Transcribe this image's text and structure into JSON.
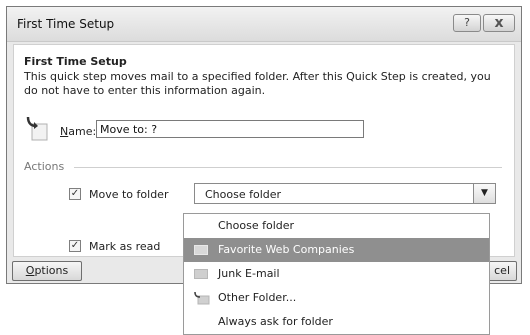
{
  "dialog": {
    "title": "First Time Setup",
    "help_glyph": "?",
    "close_glyph": "x"
  },
  "content": {
    "heading": "First Time Setup",
    "description": "This quick step moves mail to a specified folder. After this Quick Step is created, you do not have to enter this information again.",
    "name_label_mnemonic": "N",
    "name_label_rest": "ame:",
    "name_value": "Move to: ?",
    "actions_label": "Actions"
  },
  "actions": {
    "move_to_folder": {
      "label": "Move to folder",
      "checked": true
    },
    "mark_as_read": {
      "label": "Mark as read",
      "checked": true
    },
    "folder_combo_value": "Choose folder"
  },
  "footer": {
    "options_mnemonic": "O",
    "options_rest": "ptions",
    "cancel_label": "cel"
  },
  "dropdown": {
    "items": [
      {
        "label": "Choose folder",
        "icon": "none"
      },
      {
        "label": "Favorite Web Companies",
        "icon": "folder-icon",
        "selected": true
      },
      {
        "label": "Junk E-mail",
        "icon": "folder-icon"
      },
      {
        "label": "Other Folder...",
        "icon": "move-folder-icon"
      },
      {
        "label": "Always ask for folder",
        "icon": "none"
      }
    ]
  },
  "colors": {
    "selected_item_bg": "#8f8f8f",
    "dialog_bg": "#e9e9e9"
  }
}
